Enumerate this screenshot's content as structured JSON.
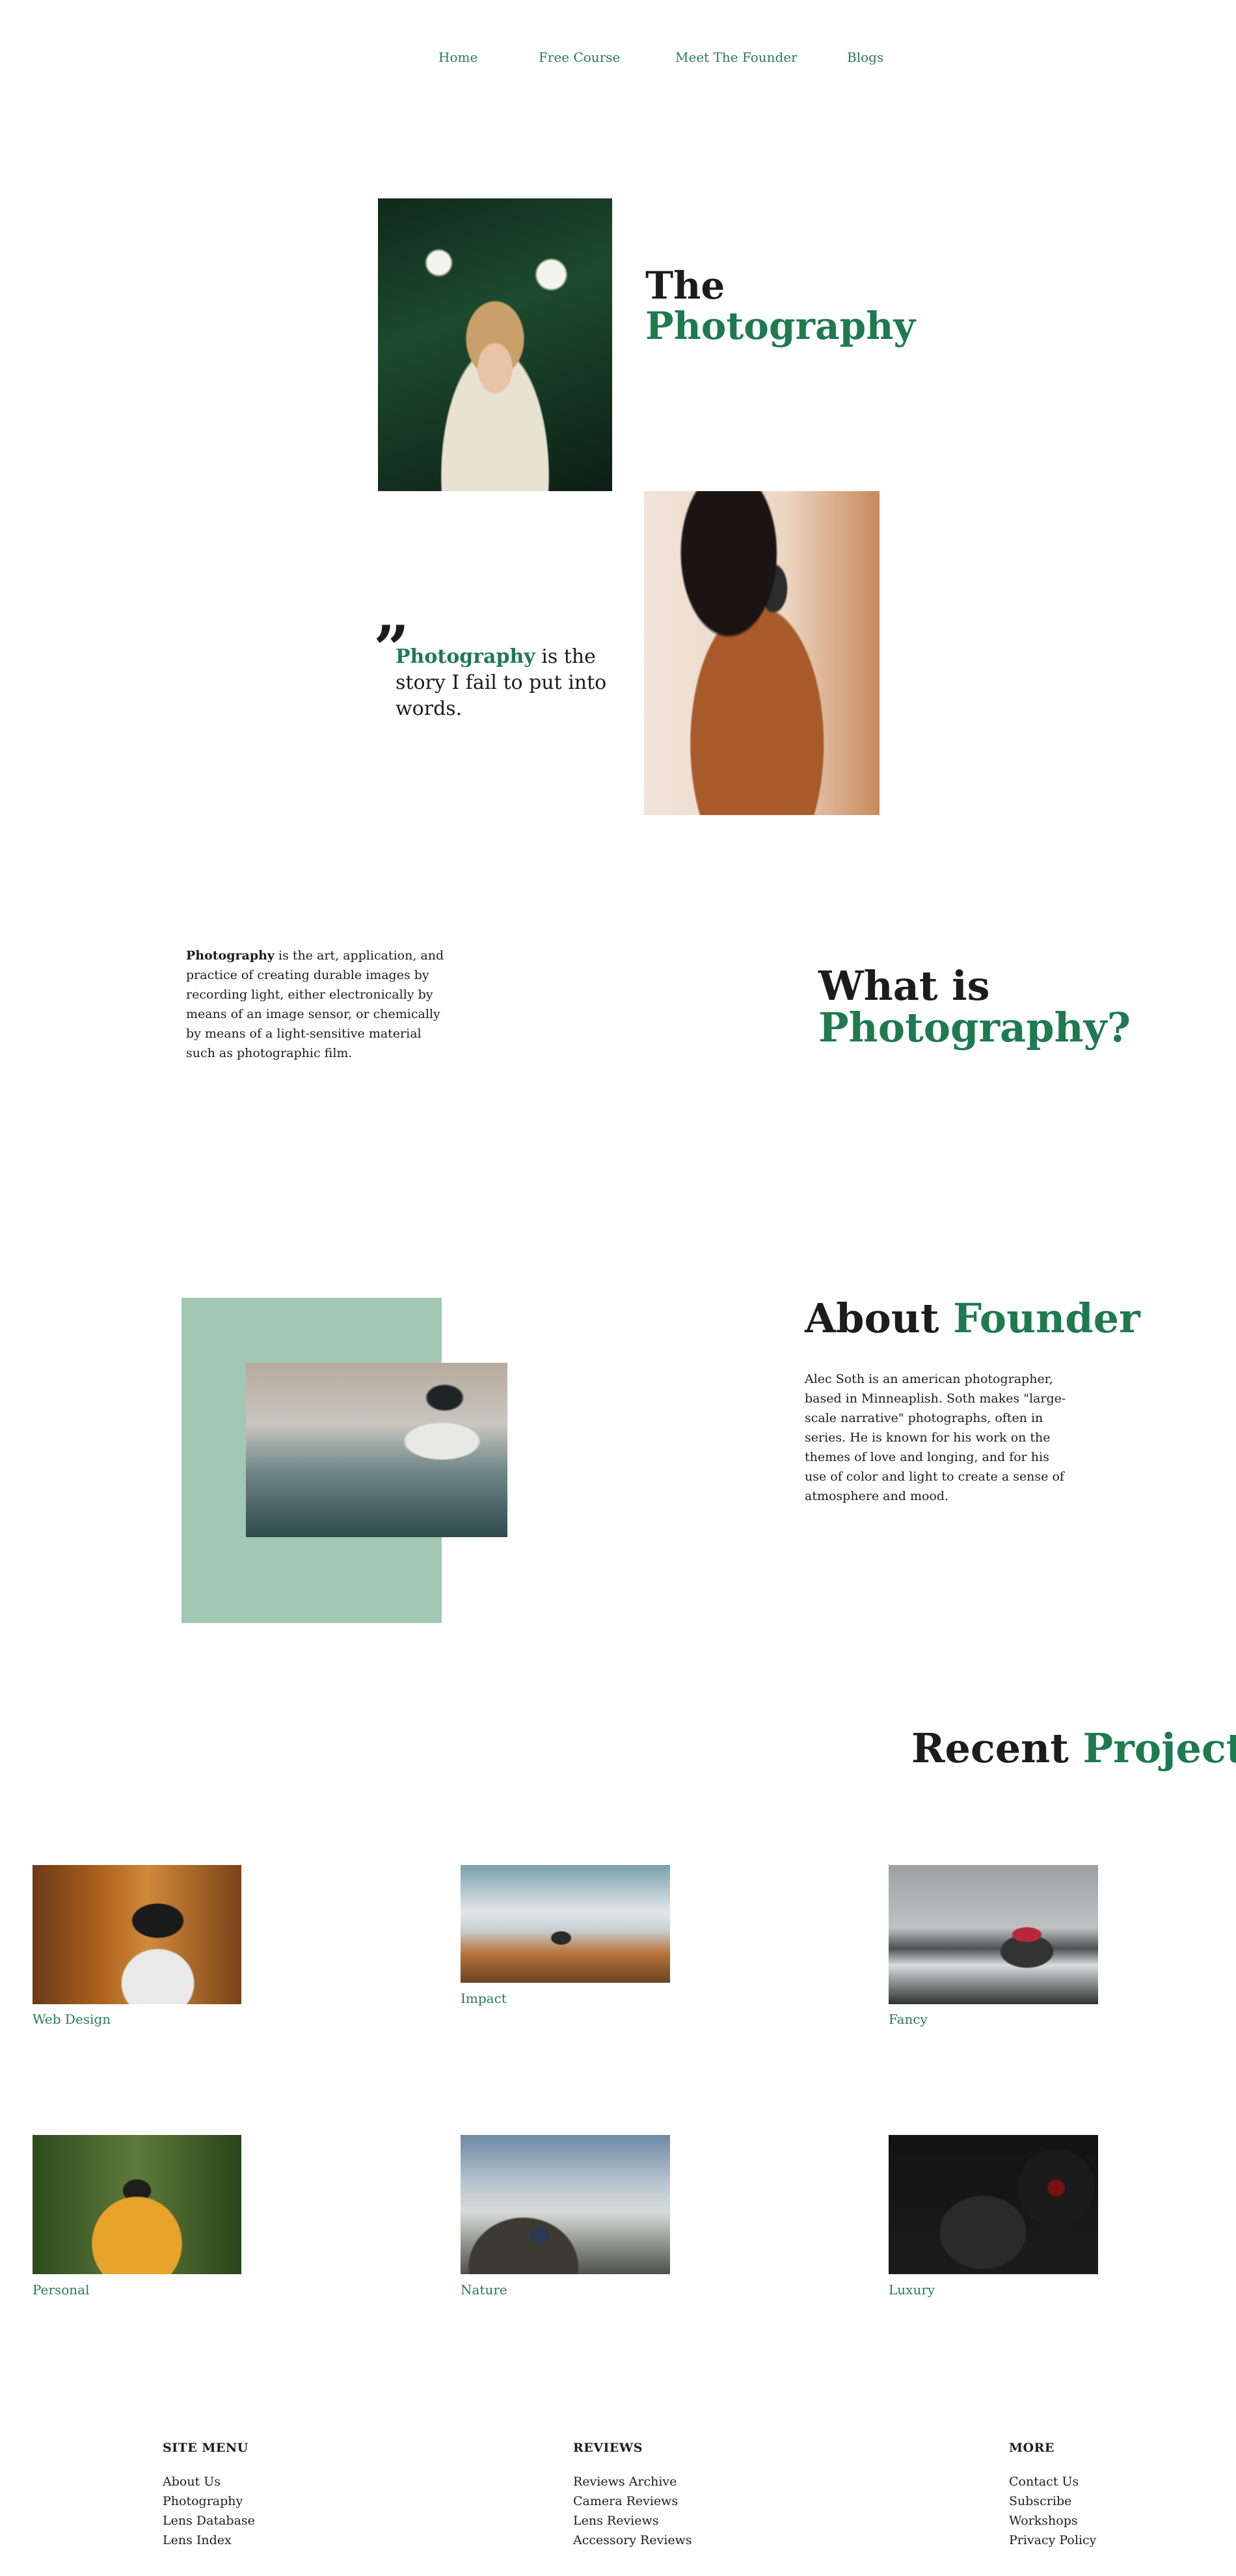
{
  "nav": {
    "items": [
      "Home",
      "Free Course",
      "Meet The Founder",
      "Blogs"
    ]
  },
  "hero": {
    "title_line1": "The",
    "title_line2": "Photography",
    "quote_mark": "”",
    "quote_highlight": "Photography",
    "quote_rest": " is the story I fail to put into words."
  },
  "what_is": {
    "body_bold": "Photography",
    "body_rest": " is the art, application, and practice of creating durable images by recording light, either electronically by means of an image sensor, or chemically by means of a light-sensitive material such as photographic film.",
    "title_line1": "What is",
    "title_line2": "Photography?"
  },
  "founder": {
    "title_plain": "About ",
    "title_green": "Founder",
    "body": "Alec Soth is an american photographer, based in Minneaplish. Soth makes \"large-scale narrative\" photographs, often in series. He is known for his work on the themes of love and longing, and for his use of color and light to create a sense of atmosphere and mood."
  },
  "projects": {
    "title_plain": "Recent ",
    "title_green": "Projects",
    "items": [
      {
        "label": "Web Design"
      },
      {
        "label": "Impact"
      },
      {
        "label": "Fancy"
      },
      {
        "label": "Personal"
      },
      {
        "label": "Nature"
      },
      {
        "label": "Luxury"
      }
    ]
  },
  "footer": {
    "columns": [
      {
        "heading": "SITE MENU",
        "links": [
          "About Us",
          "Photography",
          "Lens Database",
          "Lens Index"
        ]
      },
      {
        "heading": "REVIEWS",
        "links": [
          "Reviews Archive",
          "Camera Reviews",
          "Lens Reviews",
          "Accessory Reviews"
        ]
      },
      {
        "heading": "MORE",
        "links": [
          "Contact Us",
          "Subscribe",
          "Workshops",
          "Privacy Policy"
        ]
      }
    ]
  },
  "colors": {
    "accent": "#1e7a50",
    "nav_link": "#2a7a55",
    "founder_block": "#a2c7b3",
    "text": "#1c1c1c"
  }
}
